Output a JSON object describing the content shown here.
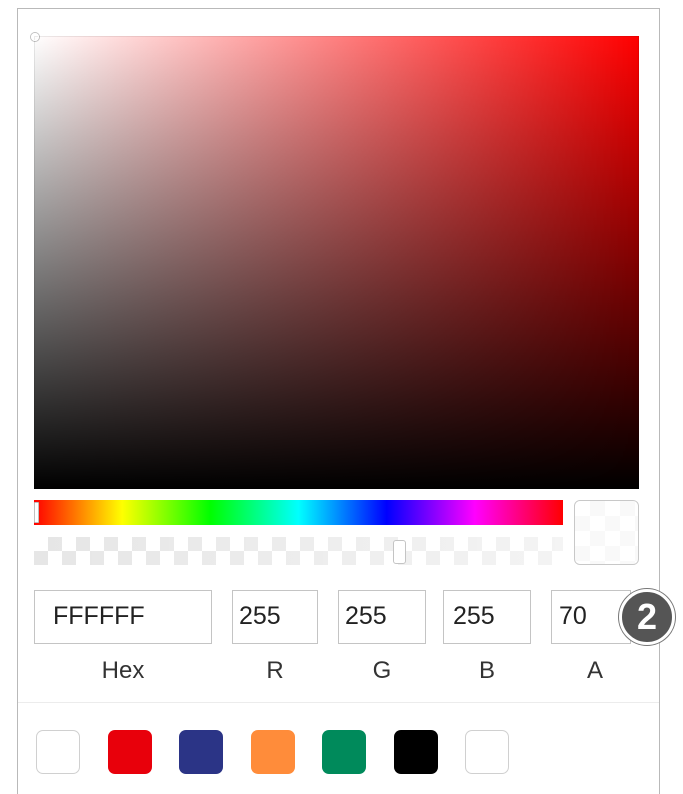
{
  "picker": {
    "hue_degrees": 0,
    "alpha_level": 0.7,
    "fields": {
      "hex": "FFFFFF",
      "r": "255",
      "g": "255",
      "b": "255",
      "a": "70"
    },
    "labels": {
      "hex": "Hex",
      "r": "R",
      "g": "G",
      "b": "B",
      "a": "A"
    }
  },
  "swatches": [
    {
      "color": "#ffffff",
      "name": "white"
    },
    {
      "color": "#e8000b",
      "name": "red"
    },
    {
      "color": "#2b3486",
      "name": "navy"
    },
    {
      "color": "#ff8c3a",
      "name": "orange"
    },
    {
      "color": "#008a5b",
      "name": "green"
    },
    {
      "color": "#000000",
      "name": "black"
    },
    {
      "color": "#ffffff",
      "name": "white-2"
    }
  ],
  "badge": {
    "label": "2"
  }
}
